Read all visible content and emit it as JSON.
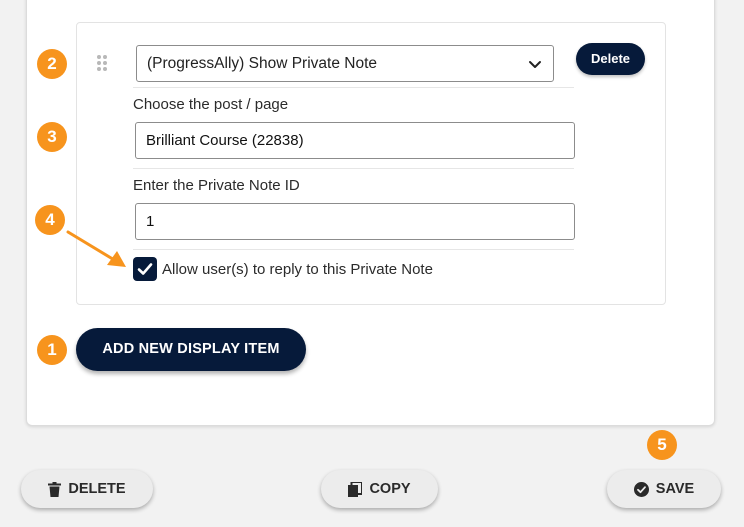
{
  "item": {
    "type_select": "(ProgressAlly) Show Private Note",
    "delete_label": "Delete",
    "post_label": "Choose the post / page",
    "post_value": "Brilliant Course (22838)",
    "note_id_label": "Enter the Private Note ID",
    "note_id_value": "1",
    "allow_reply_label": "Allow user(s) to reply to this Private Note",
    "allow_reply_checked": true
  },
  "add_item_label": "ADD NEW DISPLAY ITEM",
  "footer": {
    "delete_label": "DELETE",
    "copy_label": "COPY",
    "save_label": "SAVE"
  },
  "badges": {
    "b1": "1",
    "b2": "2",
    "b3": "3",
    "b4": "4",
    "b5": "5"
  },
  "colors": {
    "accent_orange": "#f7941d",
    "navy": "#061a3a"
  }
}
